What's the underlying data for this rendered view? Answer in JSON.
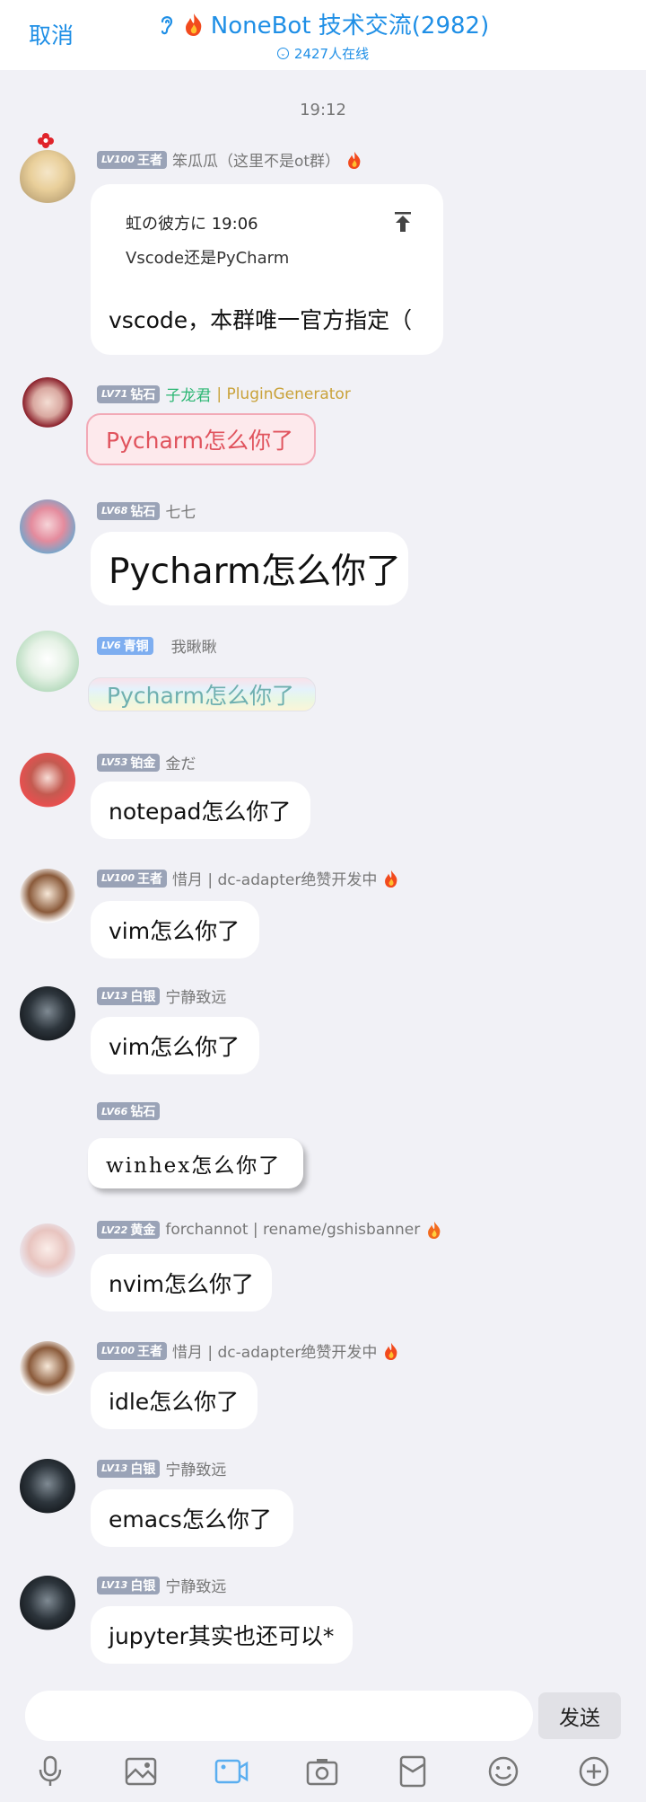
{
  "header": {
    "cancel": "取消",
    "title": "NoneBot 技术交流(2982)",
    "online": "2427人在线"
  },
  "time": "19:12",
  "messages": [
    {
      "level": "LV100",
      "rank": "王者",
      "name": "笨瓜瓜（这里不是ot群）",
      "quote_author": "虹の彼方に 19:06",
      "quote_text": "Vscode还是PyCharm",
      "text": "vscode，本群唯一官方指定（"
    },
    {
      "level": "LV71",
      "rank": "钻石",
      "name": "子龙君",
      "name_suffix": "| PluginGenerator",
      "text": "Pycharm怎么你了"
    },
    {
      "level": "LV68",
      "rank": "钻石",
      "name": "七七",
      "text": "Pycharm怎么你了"
    },
    {
      "level": "LV6",
      "rank": "青铜",
      "name": "我瞅瞅",
      "text": "Pycharm怎么你了"
    },
    {
      "level": "LV53",
      "rank": "铂金",
      "name": "金だ",
      "text": "notepad怎么你了"
    },
    {
      "level": "LV100",
      "rank": "王者",
      "name": "惜月 | dc-adapter绝赞开发中",
      "text": "vim怎么你了"
    },
    {
      "level": "LV13",
      "rank": "白银",
      "name": "宁静致远",
      "text": "vim怎么你了"
    },
    {
      "level": "LV66",
      "rank": "钻石",
      "name": "",
      "text": "winhex怎么你了"
    },
    {
      "level": "LV22",
      "rank": "黄金",
      "name": "forchannot | rename/gshisbanner",
      "text": "nvim怎么你了"
    },
    {
      "level": "LV100",
      "rank": "王者",
      "name": "惜月 | dc-adapter绝赞开发中",
      "text": "idle怎么你了"
    },
    {
      "level": "LV13",
      "rank": "白银",
      "name": "宁静致远",
      "text": "emacs怎么你了"
    },
    {
      "level": "LV13",
      "rank": "白银",
      "name": "宁静致远",
      "text": "jupyter其实也还可以*"
    }
  ],
  "input": {
    "placeholder": "",
    "send": "发送"
  },
  "toolbar": [
    "microphone-icon",
    "image-icon",
    "video-icon",
    "camera-icon",
    "red-packet-icon",
    "emoji-icon",
    "plus-icon"
  ],
  "colors": {
    "accent": "#1f8fe6",
    "active_tool": "#5aaef0"
  }
}
